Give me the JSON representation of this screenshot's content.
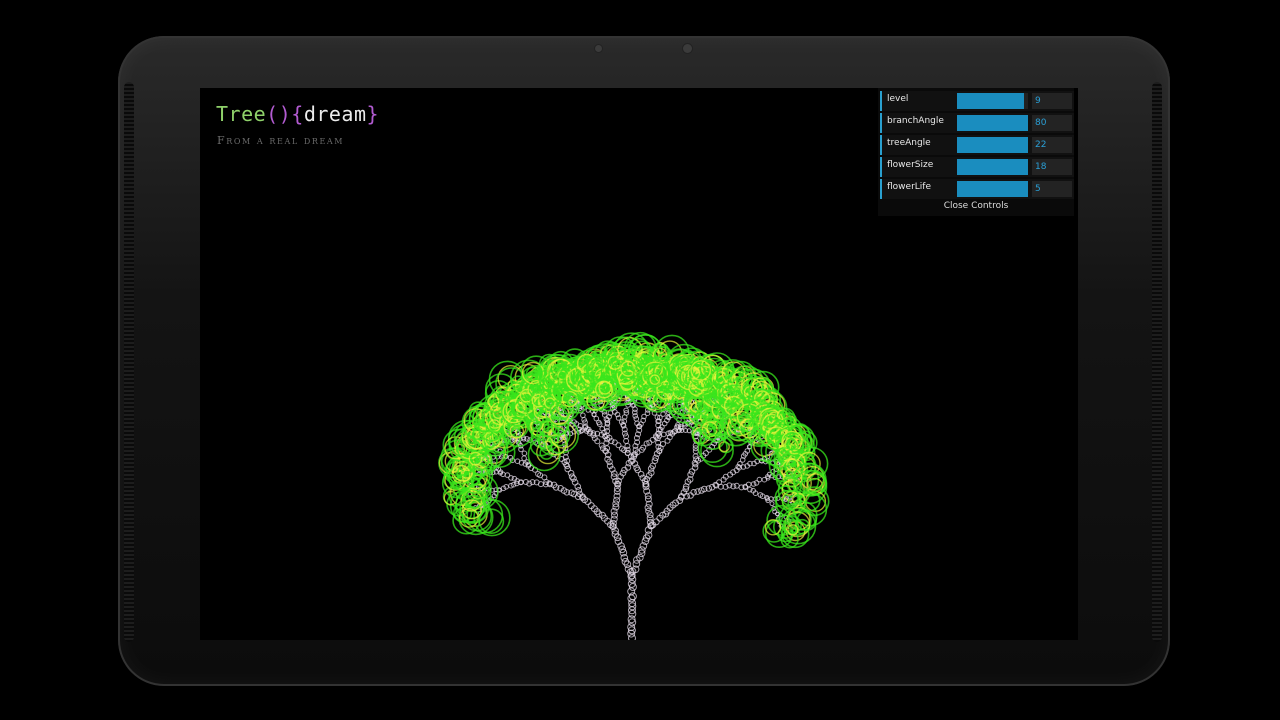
{
  "app": {
    "title": {
      "word": "Tree",
      "paren": "()",
      "brace_open": "{",
      "inner": "dream",
      "brace_close": "}"
    },
    "subtitle": "From a real dream"
  },
  "controls": {
    "rows": [
      {
        "label": "level",
        "value": "9",
        "fill": 0.95
      },
      {
        "label": "branchAngle",
        "value": "80",
        "fill": 1.0
      },
      {
        "label": "treeAngle",
        "value": "22",
        "fill": 1.0
      },
      {
        "label": "flowerSize",
        "value": "18",
        "fill": 1.0
      },
      {
        "label": "flowerLife",
        "value": "5",
        "fill": 1.0
      }
    ],
    "close_label": "Close Controls"
  },
  "colors": {
    "branch": "#e6dcea",
    "flower_outer": "#39e51c",
    "flower_inner": "#e8f23a",
    "accent": "#1a8dbf"
  }
}
